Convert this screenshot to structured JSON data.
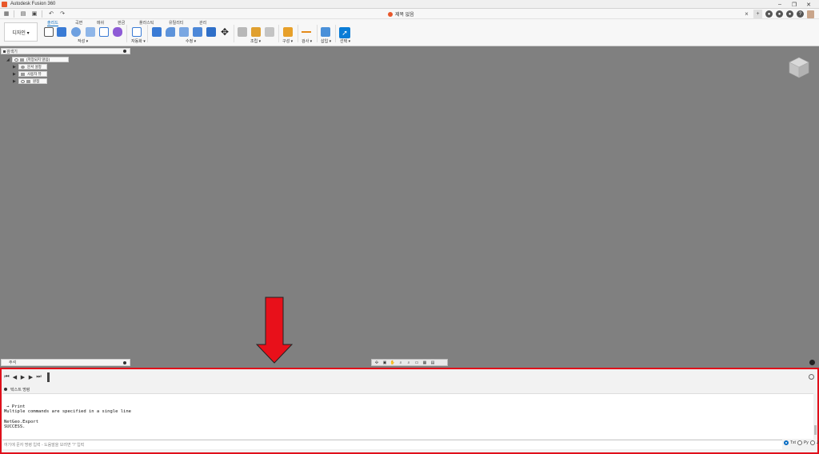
{
  "window": {
    "title": "Autodesk Fusion 360",
    "document_tab": "제목 없음"
  },
  "workspace": {
    "label": "디자인 ▾"
  },
  "ribbon": {
    "tabs": [
      "솔리드",
      "곡면",
      "메쉬",
      "판금",
      "플라스틱",
      "유틸리티",
      "관리"
    ],
    "groups": [
      "작성 ▾",
      "자동화 ▾",
      "수정 ▾",
      "조립 ▾",
      "구성 ▾",
      "검사 ▾",
      "삽입 ▾",
      "선택 ▾"
    ]
  },
  "browser": {
    "title": "검색기",
    "root": "(저장되지 않음)",
    "items": [
      "문서 설정",
      "사용자 뷰",
      "원점"
    ]
  },
  "comments": {
    "title": "주석"
  },
  "text_commands": {
    "title": "텍스트 명령",
    "output_lines": [
      " → Print",
      "Multiple commands are specified in a single line",
      "",
      "NetGeo.Export",
      "SUCCESS."
    ],
    "input_placeholder": "여기에 문자 명령 입력 - 도움말을 보려면 '?' 입력",
    "modes": [
      "Txt",
      "Py",
      "Js"
    ],
    "selected_mode": "Txt"
  },
  "colors": {
    "highlight": "#e0101b",
    "accent": "#0a6dc2",
    "canvas": "#808080"
  }
}
